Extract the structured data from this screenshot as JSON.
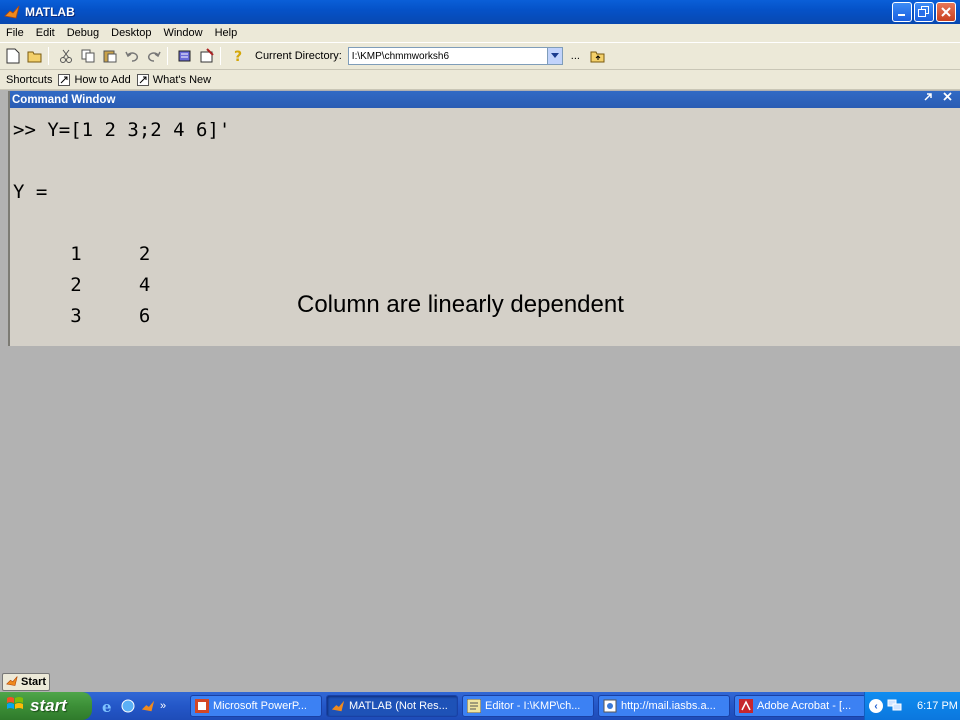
{
  "window": {
    "title": "MATLAB"
  },
  "menu": [
    "File",
    "Edit",
    "Debug",
    "Desktop",
    "Window",
    "Help"
  ],
  "toolbar": {
    "current_dir_label": "Current Directory:",
    "current_dir_value": "I:\\KMP\\chmmworksh6",
    "ellipsis": "..."
  },
  "shortcuts": {
    "label": "Shortcuts",
    "items": [
      "How to Add",
      "What's New"
    ]
  },
  "command_window": {
    "title": "Command Window",
    "lines": [
      ">> Y=[1 2 3;2 4 6]'",
      "Y =",
      "     1     2",
      "     2     4",
      "     3     6"
    ]
  },
  "annotation": "Column are linearly dependent",
  "mini_start": "Start",
  "taskbar": {
    "start_label": "start",
    "tasks": [
      "Microsoft PowerP...",
      "MATLAB (Not Res...",
      "Editor - I:\\KMP\\ch...",
      "http://mail.iasbs.a...",
      "Adobe Acrobat - [..."
    ],
    "clock": "6:17 PM"
  },
  "colors": {
    "titlebar": "#0552c8",
    "cmd_header": "#316ac5",
    "cmd_bg": "#d4d0c8",
    "overlay": "#b2b2b2",
    "taskbar": "#2457c8",
    "start": "#3c8f37"
  }
}
